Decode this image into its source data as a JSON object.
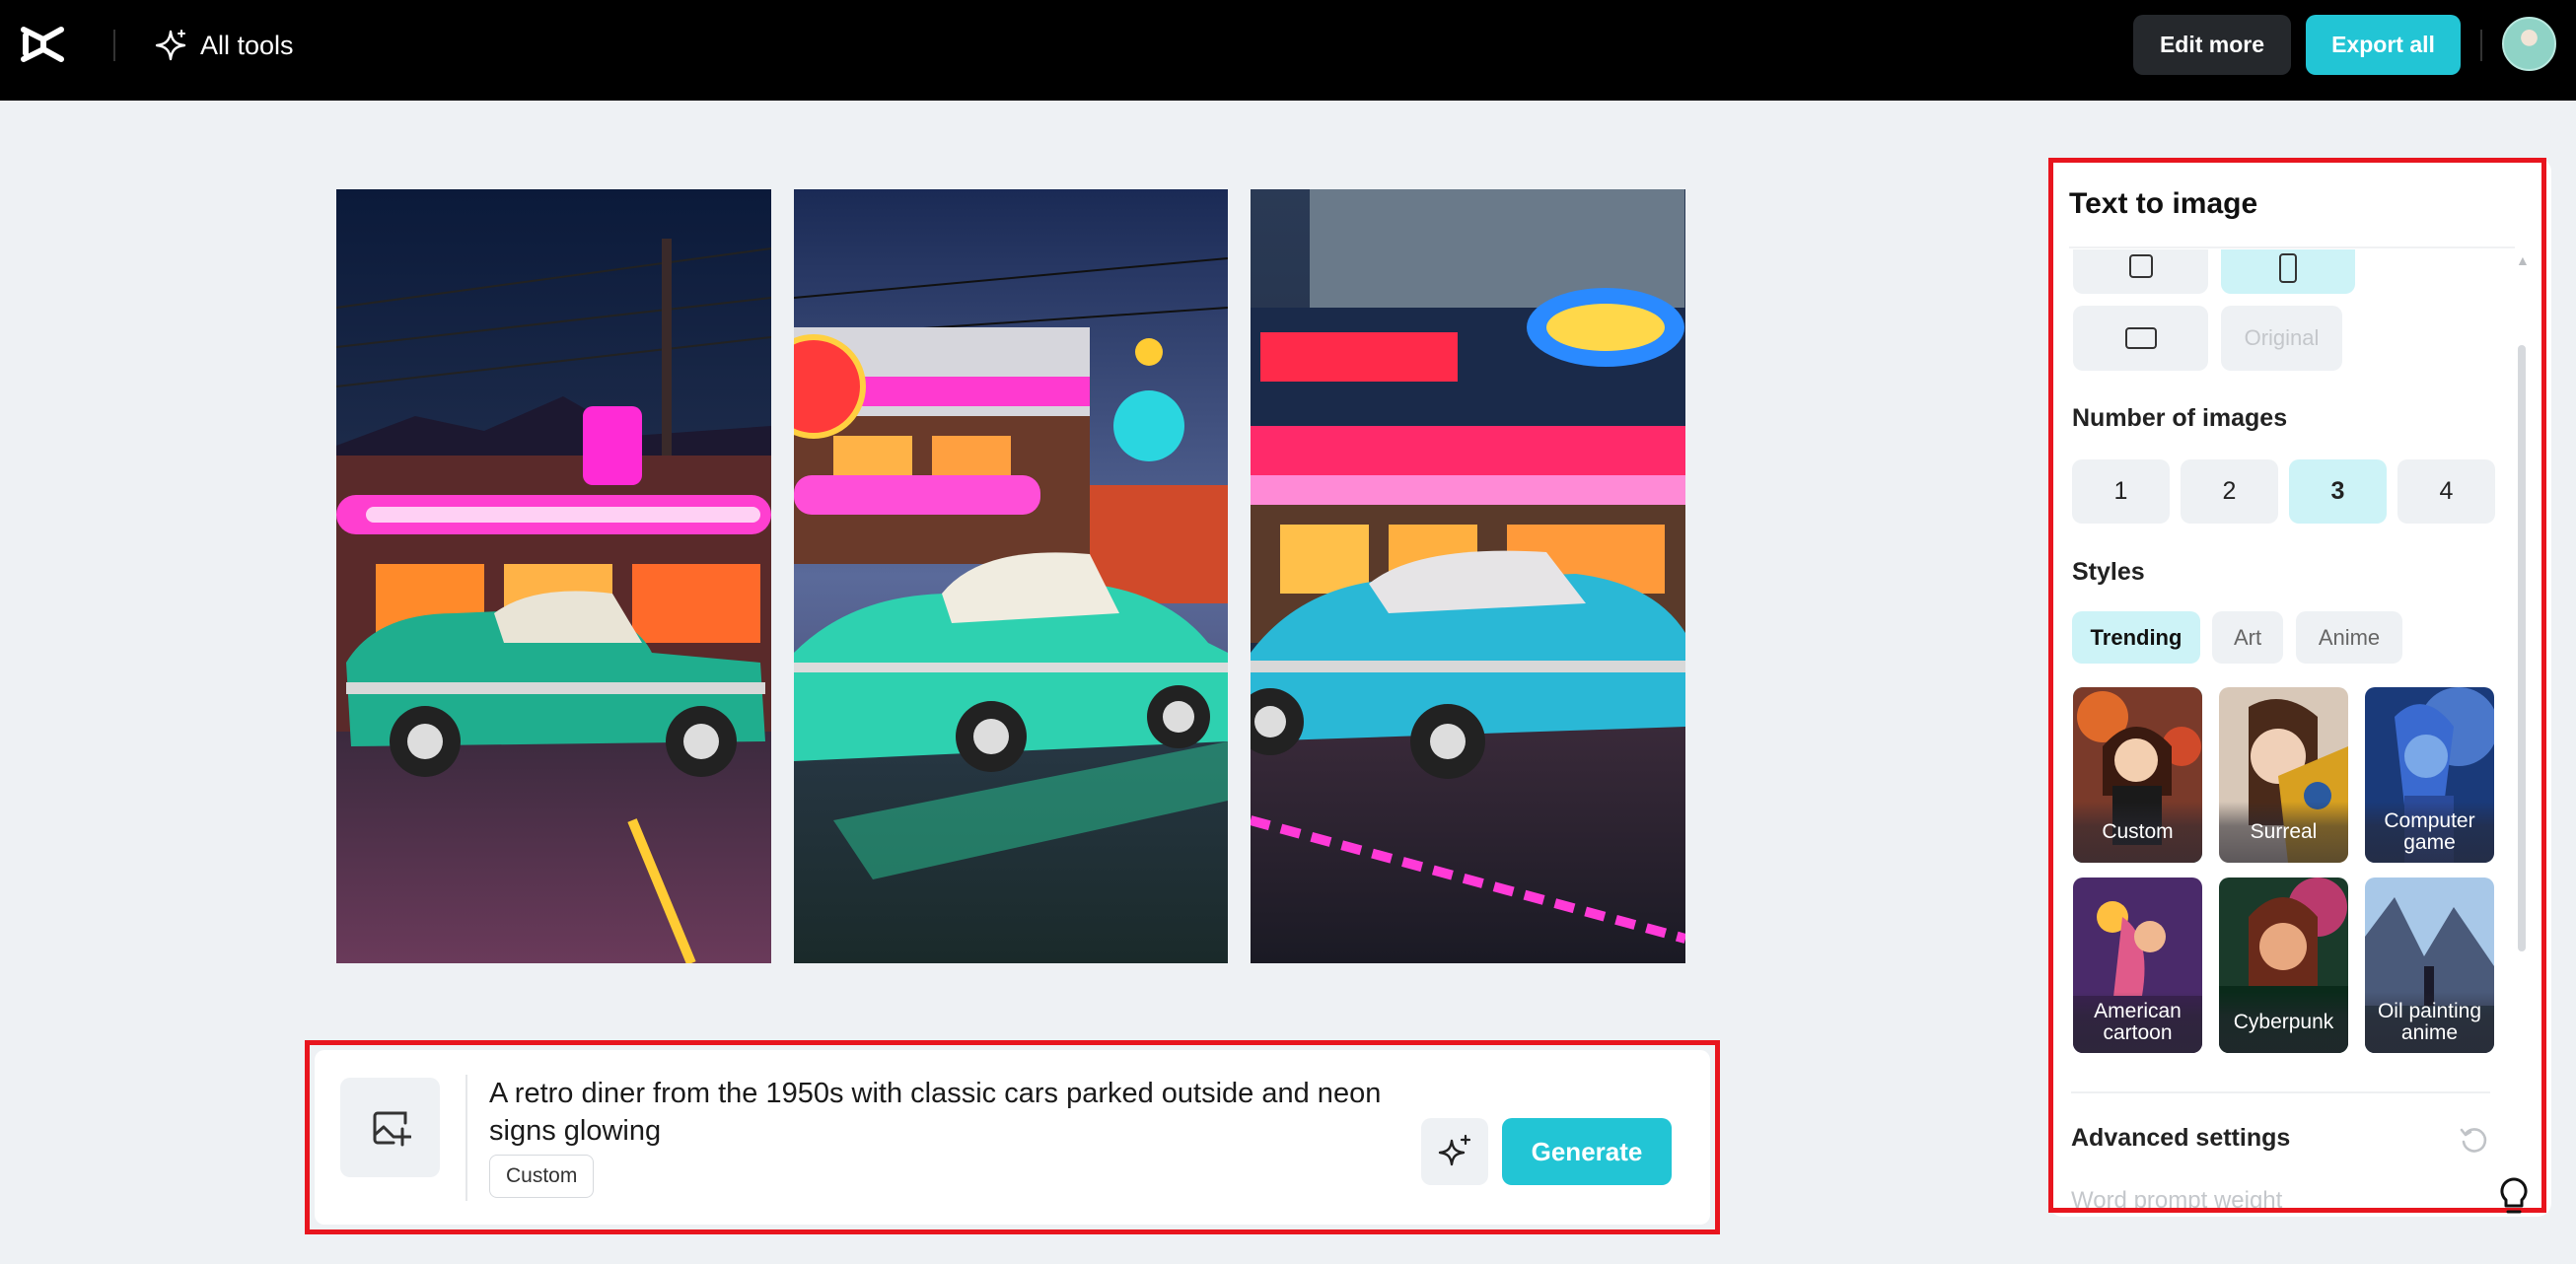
{
  "topbar": {
    "logo_icon": "capcut-logo-icon",
    "all_tools_label": "All tools",
    "edit_more_label": "Edit more",
    "export_all_label": "Export all"
  },
  "prompt": {
    "text": "A retro diner from the 1950s with classic cars parked outside and neon signs glowing",
    "style_tag": "Custom",
    "generate_label": "Generate"
  },
  "panel": {
    "title": "Text to image",
    "aspect_ratios": {
      "original_label": "Original"
    },
    "number_of_images": {
      "label": "Number of images",
      "options": [
        "1",
        "2",
        "3",
        "4"
      ],
      "selected": "3"
    },
    "styles": {
      "label": "Styles",
      "tabs": [
        "Trending",
        "Art",
        "Anime"
      ],
      "selected_tab": "Trending",
      "cards": [
        "Custom",
        "Surreal",
        "Computer game",
        "American cartoon",
        "Cyberpunk",
        "Oil painting anime"
      ],
      "selected_card": "Custom"
    },
    "advanced_settings_label": "Advanced settings",
    "word_prompt_weight_label": "Word prompt weight"
  },
  "colors": {
    "accent": "#22c5d5",
    "selected_bg": "#cdf3f7",
    "highlight_outline": "#e8151e"
  }
}
